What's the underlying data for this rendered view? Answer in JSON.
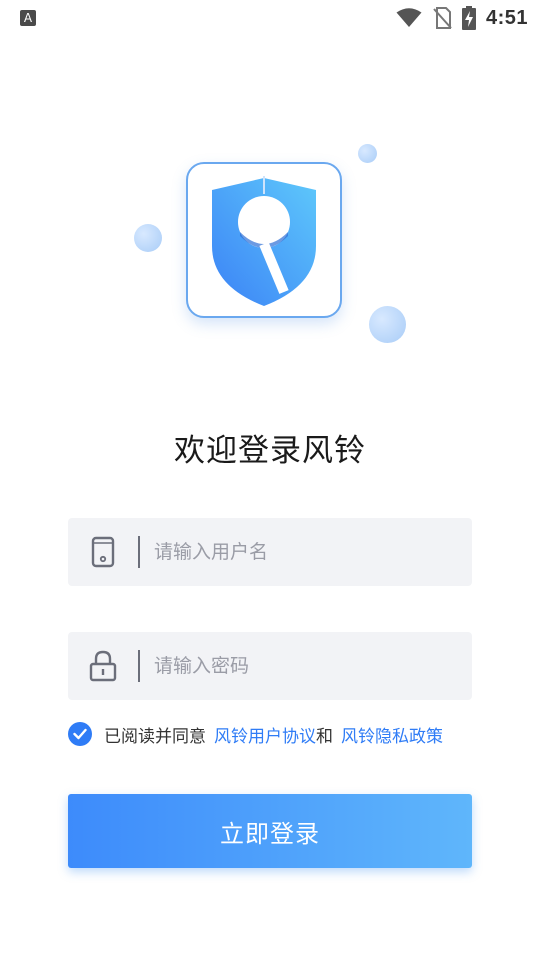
{
  "status_bar": {
    "time": "4:51",
    "left_icon": "A",
    "icons": [
      "wifi-icon",
      "no-sim-icon",
      "battery-charging-icon"
    ]
  },
  "logo": {
    "icon": "shield-windchime-logo-icon",
    "colors": {
      "border": "#6aa8ef",
      "gradient_start": "#3b82f6",
      "gradient_end": "#5ec8fb"
    }
  },
  "welcome_title": "欢迎登录风铃",
  "username_field": {
    "icon": "phone-icon",
    "placeholder": "请输入用户名",
    "value": ""
  },
  "password_field": {
    "icon": "lock-icon",
    "placeholder": "请输入密码",
    "value": ""
  },
  "agreement": {
    "checked": true,
    "prefix": "已阅读并同意",
    "user_agreement": "风铃用户协议",
    "and": "和",
    "privacy_policy": "风铃隐私政策"
  },
  "login_button": {
    "label": "立即登录"
  },
  "colors": {
    "accent": "#2f7cf6",
    "field_bg": "#f2f3f6",
    "button_gradient_start": "#3d8bfb",
    "button_gradient_end": "#5fb6fb"
  }
}
